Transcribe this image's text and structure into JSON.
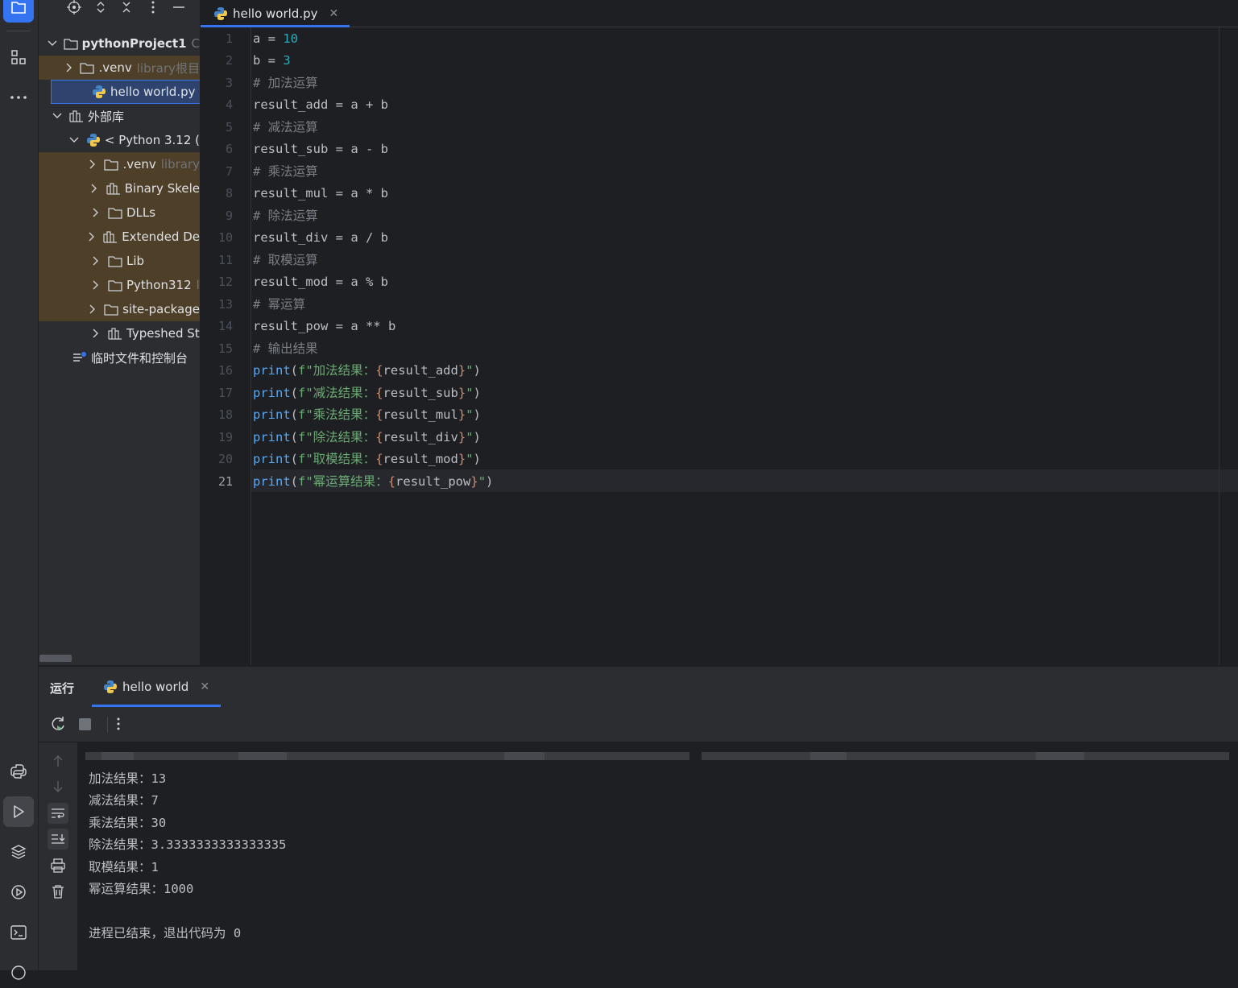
{
  "editor": {
    "tab_label": "hello world.py",
    "current_line": "21",
    "line_numbers": [
      "1",
      "2",
      "3",
      "4",
      "5",
      "6",
      "7",
      "8",
      "9",
      "10",
      "11",
      "12",
      "13",
      "14",
      "15",
      "16",
      "17",
      "18",
      "19",
      "20",
      "21"
    ]
  },
  "project_tree": {
    "root": {
      "label": "pythonProject1",
      "hint": "C"
    },
    "venv": {
      "label": ".venv",
      "hint": "library根目"
    },
    "file": {
      "label": "hello world.py"
    },
    "external": {
      "label": "外部库"
    },
    "python": {
      "label": "< Python 3.12 ("
    },
    "children": [
      {
        "label": ".venv",
        "hint": "library"
      },
      {
        "label": "Binary Skele",
        "hint": ""
      },
      {
        "label": "DLLs",
        "hint": ""
      },
      {
        "label": "Extended De",
        "hint": ""
      },
      {
        "label": "Lib",
        "hint": ""
      },
      {
        "label": "Python312",
        "hint": "l"
      },
      {
        "label": "site-package",
        "hint": ""
      },
      {
        "label": "Typeshed St",
        "hint": ""
      }
    ],
    "scratches": {
      "label": "临时文件和控制台"
    }
  },
  "run_panel": {
    "title": "运行",
    "tab_label": "hello world",
    "output": [
      "加法结果：13",
      "减法结果：7",
      "乘法结果：30",
      "除法结果：3.3333333333333335",
      "取模结果：1",
      "幂运算结果：1000",
      "",
      "进程已结束，退出代码为 0"
    ]
  },
  "code_lines": [
    "a = 10",
    "b = 3",
    "# 加法运算",
    "result_add = a + b",
    "# 减法运算",
    "result_sub = a - b",
    "# 乘法运算",
    "result_mul = a * b",
    "# 除法运算",
    "result_div = a / b",
    "# 取模运算",
    "result_mod = a % b",
    "# 幂运算",
    "result_pow = a ** b",
    "# 输出结果",
    "print(f\"加法结果：{result_add}\")",
    "print(f\"减法结果：{result_sub}\")",
    "print(f\"乘法结果：{result_mul}\")",
    "print(f\"除法结果：{result_div}\")",
    "print(f\"取模结果：{result_mod}\")",
    "print(f\"幂运算结果：{result_pow}\")"
  ],
  "colors": {
    "accent": "#3574f0",
    "keyword_number": "#2aacb8",
    "string": "#6aab73",
    "function": "#56a8f5",
    "comment": "#7a7e85",
    "excluded_bg": "#4d3f28"
  },
  "icons": [
    "project-icon",
    "structure-icon",
    "more-icon",
    "python-console-icon",
    "run-icon",
    "layers-icon",
    "services-icon",
    "terminal-icon",
    "locate-icon",
    "expand-icon",
    "collapse-icon",
    "options-icon",
    "hide-icon",
    "rerun-icon",
    "stop-icon",
    "up-icon",
    "down-icon",
    "soft-wrap-icon",
    "scroll-end-icon",
    "print-icon",
    "trash-icon"
  ]
}
